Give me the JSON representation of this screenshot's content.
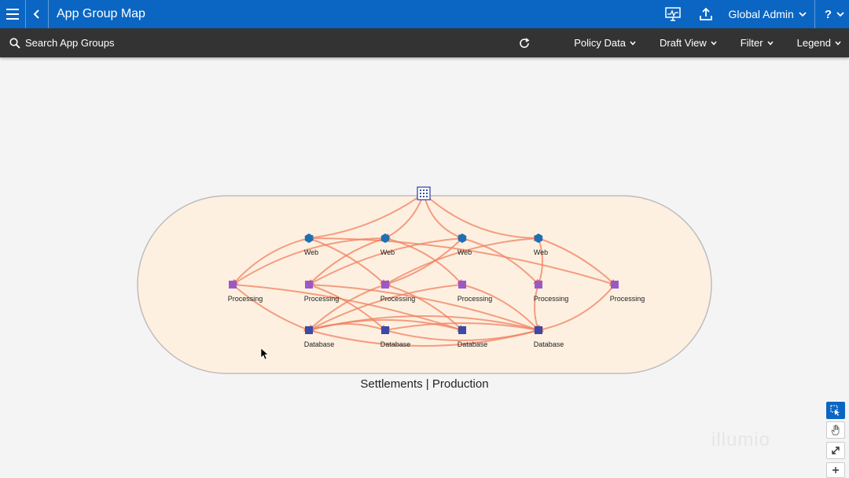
{
  "header": {
    "title": "App Group Map",
    "user_label": "Global Admin",
    "help_label": "?"
  },
  "toolbar": {
    "search_placeholder": "Search App Groups",
    "policy_data_label": "Policy Data",
    "draft_view_label": "Draft View",
    "filter_label": "Filter",
    "legend_label": "Legend"
  },
  "group": {
    "label": "Settlements | Production",
    "fill_color": "#fdf0e0",
    "border_color": "#bdbdbd"
  },
  "nodes": {
    "web_label": "Web",
    "processing_label": "Processing",
    "database_label": "Database",
    "web_color": "#1f6fb5",
    "processing_color": "#9b59c6",
    "database_color": "#3a4aa6",
    "edge_color": "#f08060",
    "web_count": 4,
    "processing_count": 6,
    "database_count": 4
  },
  "icons": {
    "menu": "hamburger-icon",
    "back": "chevron-left-icon",
    "monitor": "monitor-icon",
    "upload": "upload-icon",
    "search": "search-icon",
    "refresh": "refresh-icon",
    "internet": "internet-grid-icon",
    "select": "select-pointer-icon",
    "pan": "hand-icon",
    "fit": "expand-icon",
    "zoom_in": "plus-icon"
  },
  "watermark": "illumio"
}
